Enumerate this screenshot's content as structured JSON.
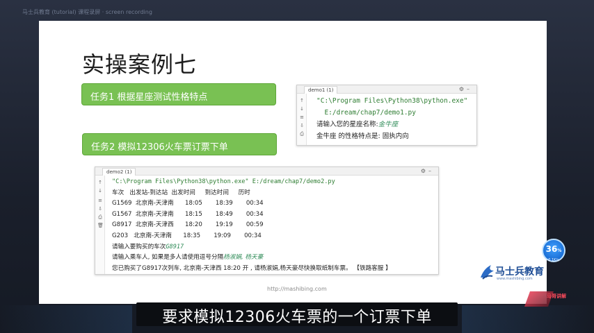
{
  "frame": {
    "top_text": "马士兵教育 (tutorial) 课程录屏 · screen recording"
  },
  "slide": {
    "title": "实操案例七",
    "task1": "任务1   根据星座测试性格特点",
    "task2": "任务2   模拟12306火车票订票下单",
    "url": "http://mashibing.com"
  },
  "console1": {
    "tab": "demo1 (1)",
    "lines": {
      "l1": "\"C:\\Program Files\\Python38\\python.exe\"",
      "l2": "  E:/dream/chap7/demo1.py",
      "l3_prompt": "请输入您的星座名称:",
      "l3_input": "金牛座",
      "l4": "金牛座 的性格特点是: 固执内向"
    }
  },
  "console2": {
    "tab": "demo2 (1)",
    "lines": {
      "l1": "\"C:\\Program Files\\Python38\\python.exe\" E:/dream/chap7/demo2.py",
      "header": "车次   出发站-到达站  出发时间     到达时间     历时",
      "r1": "G1569  北京南-天津南      18:05       18:39       00:34",
      "r2": "G1567  北京南-天津南      18:15       18:49       00:34",
      "r3": "G8917  北京南-天津西      18:20       19:19       00:59",
      "r4": "G203   北京南-天津南      18:35       19:09       00:34",
      "l_prompt1": "请输入要购买的车次",
      "l_input1": "G8917",
      "l_prompt2": "请输入乘车人, 如果是多人请使用逗号分隔",
      "l_input2": "杨淑娟, 杨天豪",
      "l_result": "您已购买了G8917次列车, 北京南-天津西 18:20 开 , 请杨淑娟,杨天豪尽快换取纸制车票。 【铁路客服 】"
    }
  },
  "logo": {
    "name": "马士兵教育",
    "sub": "www.mashibing.com"
  },
  "badge": {
    "value": "36",
    "unit": "%",
    "sub": "0.1K/s"
  },
  "corner": {
    "tag": "马哥讲解"
  },
  "subtitle": "要求模拟12306火车票的一个订票下单"
}
